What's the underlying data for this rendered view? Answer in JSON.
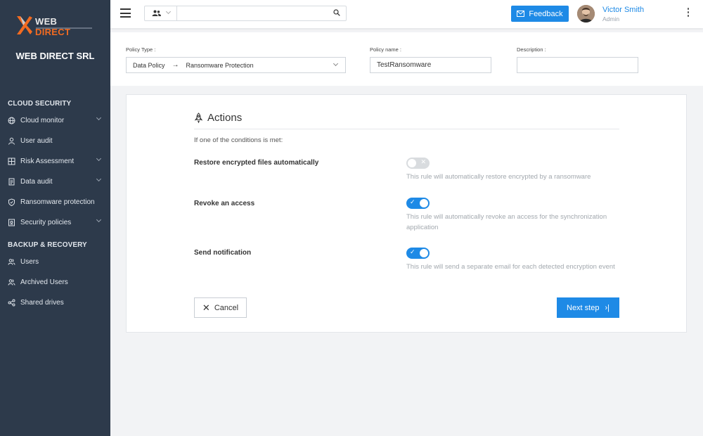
{
  "sidebar": {
    "logo_text_a": "WEB",
    "logo_text_b": "DIRECT",
    "company": "WEB DIRECT SRL",
    "sections": [
      {
        "title": "CLOUD SECURITY"
      },
      {
        "title": "BACKUP & RECOVERY"
      }
    ],
    "items": [
      {
        "label": "Cloud monitor",
        "icon": "globe-icon"
      },
      {
        "label": "User audit",
        "icon": "user-icon"
      },
      {
        "label": "Risk Assessment",
        "icon": "grid-icon"
      },
      {
        "label": "Data audit",
        "icon": "document-icon"
      },
      {
        "label": "Ransomware protection",
        "icon": "shield-icon"
      },
      {
        "label": "Security policies",
        "icon": "policy-icon"
      },
      {
        "label": "Users",
        "icon": "users-icon"
      },
      {
        "label": "Archived Users",
        "icon": "archived-users-icon"
      },
      {
        "label": "Shared drives",
        "icon": "share-icon"
      }
    ]
  },
  "topbar": {
    "search_placeholder": "",
    "feedback_label": "Feedback",
    "user_name": "Victor Smith",
    "user_role": "Admin"
  },
  "policy": {
    "type_label": "Policy Type :",
    "type_value_a": "Data Policy",
    "type_value_b": "Ransomware Protection",
    "name_label": "Policy name :",
    "name_value": "TestRansomware",
    "description_label": "Description :",
    "description_value": ""
  },
  "actions": {
    "title": "Actions",
    "condition": "If one of the conditions is met:",
    "rules": [
      {
        "label": "Restore encrypted files automatically",
        "enabled": false,
        "description": "This rule will automatically restore encrypted by a ransomware"
      },
      {
        "label": "Revoke an access",
        "enabled": true,
        "description": "This rule will automatically revoke an access for the synchronization application"
      },
      {
        "label": "Send notification",
        "enabled": true,
        "description": "This rule will send a separate email for each detected encryption event"
      }
    ],
    "cancel_label": "Cancel",
    "next_label": "Next step"
  },
  "colors": {
    "sidebar_bg": "#2d3a4b",
    "accent": "#1e8ae6",
    "logo_orange": "#f26b21"
  }
}
